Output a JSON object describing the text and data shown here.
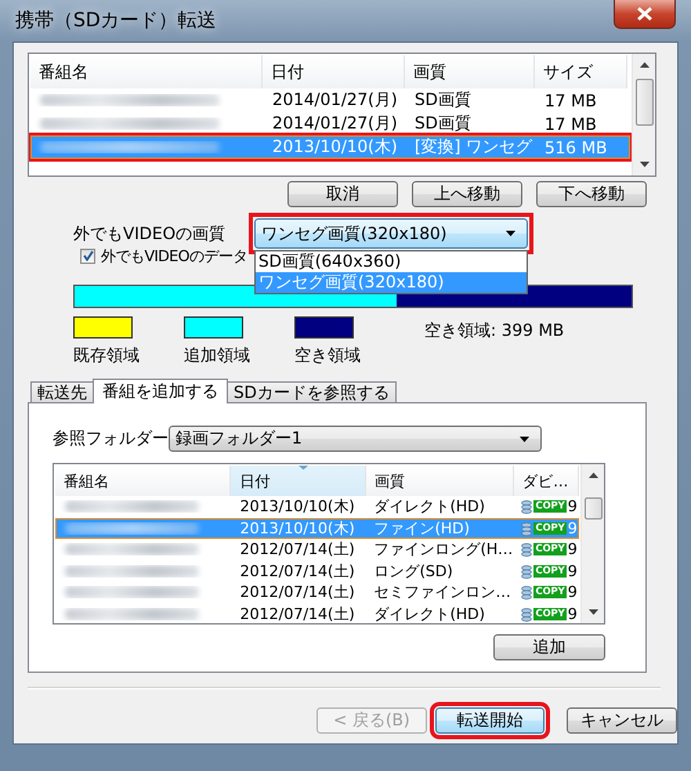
{
  "window": {
    "title": "携帯（SDカード）転送"
  },
  "transfer_list": {
    "columns": [
      "番組名",
      "日付",
      "画質",
      "サイズ"
    ],
    "rows": [
      {
        "date": "2014/01/27(月)",
        "quality": "SD画質",
        "size": "17 MB",
        "selected": false,
        "highlighted": false
      },
      {
        "date": "2014/01/27(月)",
        "quality": "SD画質",
        "size": "17 MB",
        "selected": false,
        "highlighted": false
      },
      {
        "date": "2013/10/10(木)",
        "quality": "[変換] ワンセグ",
        "size": "516 MB",
        "selected": true,
        "highlighted": true
      }
    ]
  },
  "list_buttons": [
    "取消",
    "上へ移動",
    "下へ移動"
  ],
  "quality": {
    "label": "外でもVIDEOの画質",
    "value": "ワンセグ画質(320x180)",
    "highlighted": true,
    "options": [
      {
        "label": "SD画質(640x360)",
        "selected": false
      },
      {
        "label": "ワンセグ画質(320x180)",
        "selected": true
      }
    ]
  },
  "convert_checkbox": {
    "label": "外でもVIDEOのデータ",
    "checked": true
  },
  "usage_bar": {
    "segments": [
      {
        "label": "既存領域",
        "color": "#ffff00"
      },
      {
        "label": "追加領域",
        "color": "#00ffff",
        "level": 0.578
      },
      {
        "label": "空き領域",
        "color": "#000080",
        "level": 0.422
      }
    ],
    "free_text": "空き領域: 399 MB"
  },
  "tabs": [
    {
      "label": "転送先",
      "selected": false
    },
    {
      "label": "番組を追加する",
      "selected": true
    },
    {
      "label": "SDカードを参照する",
      "selected": false
    }
  ],
  "folder": {
    "label": "参照フォルダー",
    "value": "録画フォルダー1"
  },
  "programs": {
    "columns": [
      {
        "label": "番組名",
        "sorted": false
      },
      {
        "label": "日付",
        "sorted": true
      },
      {
        "label": "画質",
        "sorted": false
      },
      {
        "label": "ダビ…",
        "sorted": false
      }
    ],
    "rows": [
      {
        "date": "2013/10/10(木)",
        "quality": "ダイレクト(HD)",
        "badge": "COPY",
        "copies": "9",
        "selected": false
      },
      {
        "date": "2013/10/10(木)",
        "quality": "ファイン(HD)",
        "badge": "COPY",
        "copies": "9",
        "selected": true
      },
      {
        "date": "2012/07/14(土)",
        "quality": "ファインロング(H…",
        "badge": "COPY",
        "copies": "9",
        "selected": false
      },
      {
        "date": "2012/07/14(土)",
        "quality": "ロング(SD)",
        "badge": "COPY",
        "copies": "9",
        "selected": false
      },
      {
        "date": "2012/07/14(土)",
        "quality": "セミファインロン…",
        "badge": "COPY",
        "copies": "9",
        "selected": false
      },
      {
        "date": "2012/07/14(土)",
        "quality": "ダイレクト(HD)",
        "badge": "COPY",
        "copies": "9",
        "selected": false
      }
    ]
  },
  "add_button": "追加",
  "footer_buttons": [
    {
      "label": "< 戻る(B)",
      "disabled": true,
      "default": false,
      "highlighted": false
    },
    {
      "label": "転送開始",
      "disabled": false,
      "default": true,
      "highlighted": true
    },
    {
      "label": "キャンセル",
      "disabled": false,
      "default": false,
      "highlighted": false
    }
  ]
}
